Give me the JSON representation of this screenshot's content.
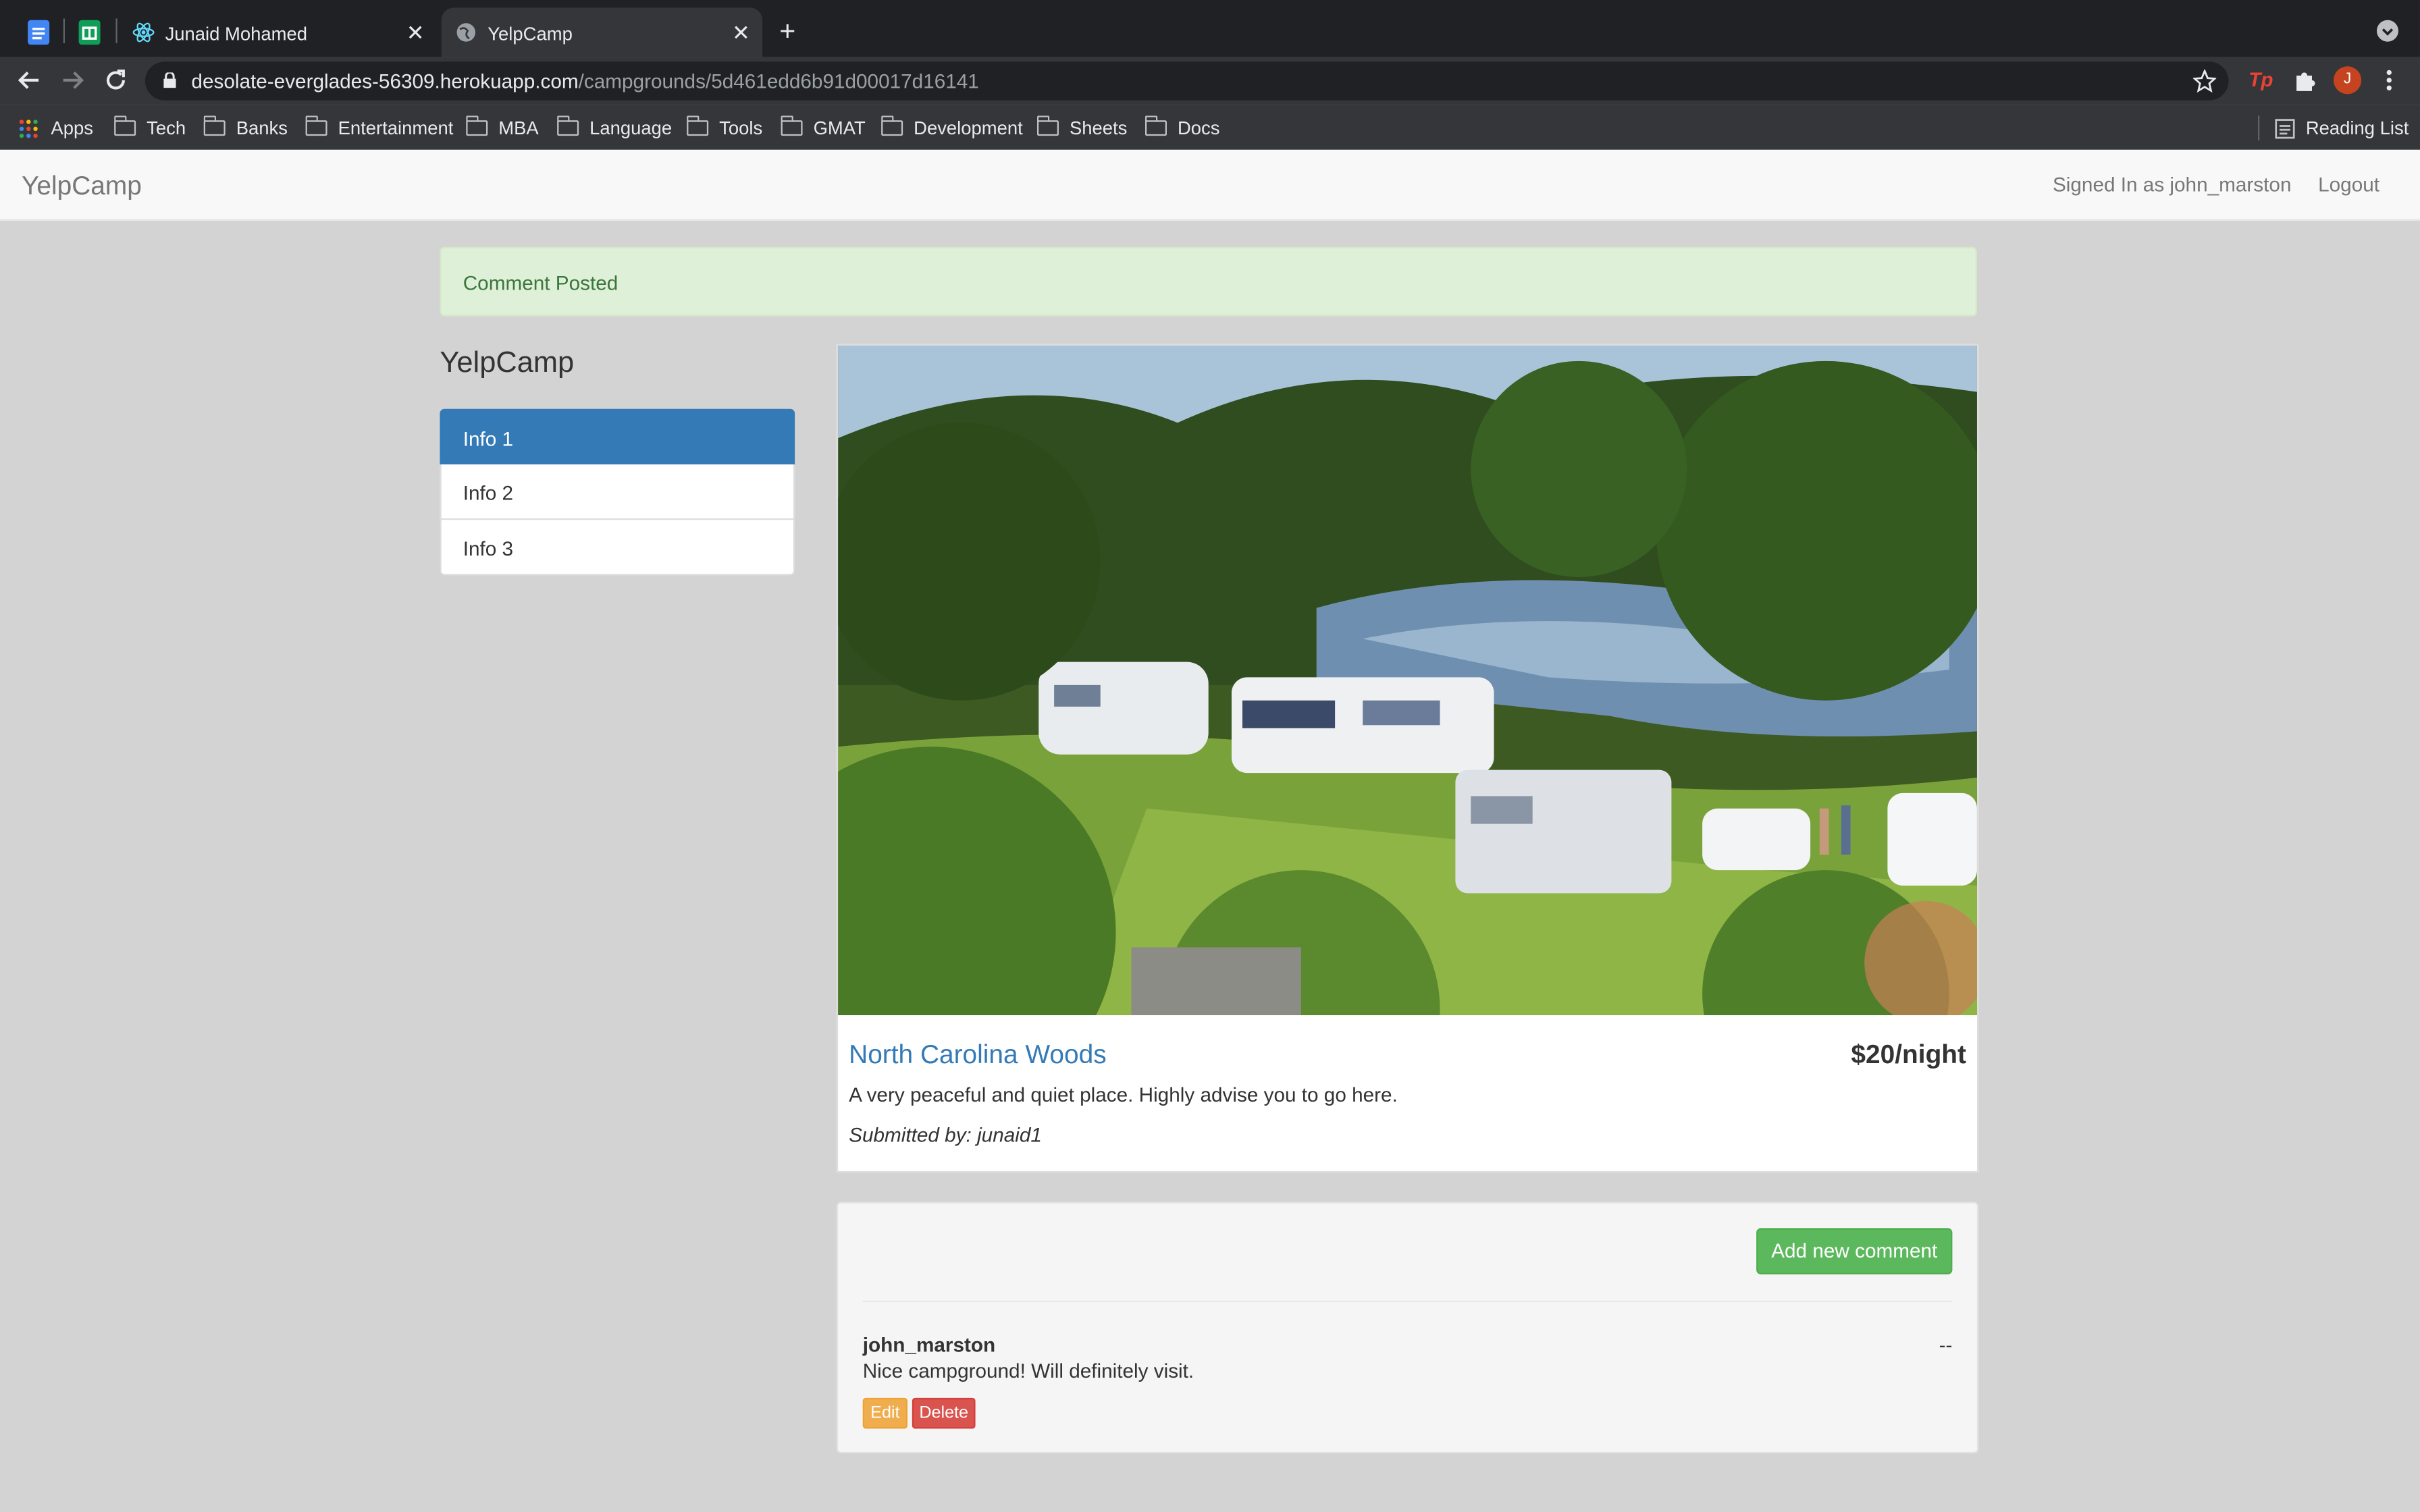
{
  "browser": {
    "tabs": [
      {
        "label": "Junaid Mohamed",
        "icon": "react-icon"
      },
      {
        "label": "YelpCamp",
        "icon": "globe-icon",
        "active": true
      }
    ],
    "new_tab": "+",
    "url_host": "desolate-everglades-56309.herokuapp.com",
    "url_path": "/campgrounds/5d461edd6b91d00017d16141",
    "profile_initial": "J",
    "bookmarks": [
      "Apps",
      "Tech",
      "Banks",
      "Entertainment",
      "MBA",
      "Language",
      "Tools",
      "GMAT",
      "Development",
      "Sheets",
      "Docs"
    ],
    "reading_list": "Reading List"
  },
  "navbar": {
    "brand": "YelpCamp",
    "signed_in": "Signed In as john_marston",
    "logout": "Logout"
  },
  "flash": "Comment Posted",
  "sidebar": {
    "title": "YelpCamp",
    "items": [
      "Info 1",
      "Info 2",
      "Info 3"
    ],
    "active_index": 0
  },
  "campground": {
    "name": "North Carolina Woods",
    "price": "$20/night",
    "description": "A very peaceful and quiet place. Highly advise you to go here.",
    "submitted_by": "Submitted by: junaid1"
  },
  "comments": {
    "add_button": "Add new comment",
    "items": [
      {
        "author": "john_marston",
        "date": "--",
        "text": "Nice campground! Will definitely visit.",
        "edit": "Edit",
        "delete": "Delete"
      }
    ]
  },
  "colors": {
    "primary": "#337ab7",
    "success": "#5cb85c",
    "warning": "#f0ad4e",
    "danger": "#d9534f",
    "alert_bg": "#dff0d8"
  }
}
